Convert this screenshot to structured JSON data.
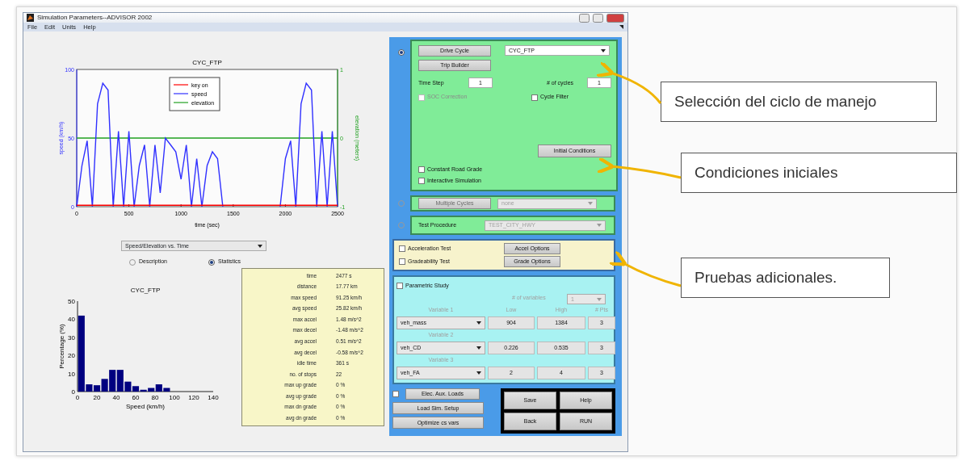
{
  "window": {
    "title": "Simulation Parameters--ADVISOR 2002"
  },
  "menu": [
    "File",
    "Edit",
    "Units",
    "Help"
  ],
  "main_chart": {
    "chart_data": {
      "type": "line",
      "title": "CYC_FTP",
      "xlabel": "time (sec)",
      "ylabel": "speed (km/h)",
      "y2label": "elevation (meters)",
      "xlim": [
        0,
        2500
      ],
      "ylim": [
        0,
        100
      ],
      "y2lim": [
        -1,
        1
      ],
      "xticks": [
        0,
        500,
        1000,
        1500,
        2000,
        2500
      ],
      "yticks": [
        0,
        50,
        100
      ],
      "y2ticks": [
        -1,
        0,
        1
      ],
      "legend": "upper center",
      "x": [
        0,
        50,
        100,
        150,
        200,
        250,
        300,
        350,
        400,
        450,
        500,
        550,
        600,
        650,
        700,
        750,
        800,
        850,
        900,
        950,
        1000,
        1050,
        1100,
        1150,
        1200,
        1250,
        1300,
        1350,
        1400,
        1450,
        1500,
        1550,
        1600,
        1650,
        1700,
        1750,
        1800,
        1850,
        1900,
        1950,
        2000,
        2050,
        2100,
        2150,
        2200,
        2250,
        2300,
        2350,
        2400,
        2450,
        2500
      ],
      "series": [
        {
          "name": "key on",
          "color": "#ff0000",
          "axis": "y",
          "values": [
            1,
            1,
            1,
            1,
            1,
            1,
            1,
            1,
            1,
            1,
            1,
            1,
            1,
            1,
            1,
            1,
            1,
            1,
            1,
            1,
            1,
            1,
            1,
            1,
            1,
            1,
            1,
            1,
            1,
            1,
            1,
            1,
            1,
            1,
            1,
            1,
            1,
            1,
            1,
            1,
            1,
            1,
            1,
            1,
            1,
            1,
            1,
            1,
            1,
            1,
            1
          ]
        },
        {
          "name": "speed",
          "color": "#3030ff",
          "axis": "y",
          "values": [
            0,
            30,
            48,
            0,
            75,
            90,
            85,
            0,
            55,
            0,
            55,
            0,
            30,
            45,
            0,
            45,
            10,
            50,
            45,
            40,
            20,
            45,
            0,
            35,
            0,
            30,
            40,
            35,
            0,
            null,
            null,
            null,
            null,
            null,
            null,
            null,
            null,
            null,
            null,
            0,
            35,
            48,
            0,
            75,
            90,
            85,
            0,
            55,
            0,
            55,
            0
          ]
        },
        {
          "name": "elevation",
          "color": "#20a020",
          "axis": "y2",
          "values": [
            0,
            0,
            0,
            0,
            0,
            0,
            0,
            0,
            0,
            0,
            0,
            0,
            0,
            0,
            0,
            0,
            0,
            0,
            0,
            0,
            0,
            0,
            0,
            0,
            0,
            0,
            0,
            0,
            0,
            0,
            0,
            0,
            0,
            0,
            0,
            0,
            0,
            0,
            0,
            0,
            0,
            0,
            0,
            0,
            0,
            0,
            0,
            0,
            0,
            0,
            0
          ]
        }
      ]
    }
  },
  "plot_select": {
    "value": "Speed/Elevation vs. Time"
  },
  "view_options": [
    {
      "label": "Description",
      "selected": false
    },
    {
      "label": "Statistics",
      "selected": true
    }
  ],
  "histogram": {
    "chart_data": {
      "type": "bar",
      "title": "CYC_FTP",
      "xlabel": "Speed (km/h)",
      "ylabel": "Percentage (%)",
      "xlim": [
        0,
        140
      ],
      "ylim": [
        0,
        50
      ],
      "xticks": [
        0,
        20,
        40,
        60,
        80,
        100,
        120,
        140
      ],
      "yticks": [
        0,
        10,
        20,
        30,
        40,
        50
      ],
      "x": [
        4,
        12,
        20,
        28,
        36,
        44,
        52,
        60,
        68,
        76,
        84,
        92
      ],
      "series": [
        {
          "color": "#000080",
          "values": [
            42,
            4,
            3.5,
            7,
            12,
            12,
            5.5,
            3,
            1,
            2,
            4,
            2
          ]
        }
      ]
    }
  },
  "statistics": [
    {
      "label": "time",
      "value": "2477 s"
    },
    {
      "label": "distance",
      "value": "17.77 km"
    },
    {
      "label": "max speed",
      "value": "91.25 km/h"
    },
    {
      "label": "avg speed",
      "value": "25.82 km/h"
    },
    {
      "label": "max accel",
      "value": "1.48 m/s^2"
    },
    {
      "label": "max decel",
      "value": "-1.48 m/s^2"
    },
    {
      "label": "avg accel",
      "value": "0.51 m/s^2"
    },
    {
      "label": "avg decel",
      "value": "-0.58 m/s^2"
    },
    {
      "label": "idle time",
      "value": "361 s"
    },
    {
      "label": "no. of stops",
      "value": "22"
    },
    {
      "label": "max up grade",
      "value": "0 %"
    },
    {
      "label": "avg up grade",
      "value": "0 %"
    },
    {
      "label": "max dn grade",
      "value": "0 %"
    },
    {
      "label": "avg dn grade",
      "value": "0 %"
    }
  ],
  "drive_cycle_panel": {
    "selected": true,
    "drive_cycle_button": "Drive Cycle",
    "trip_builder_button": "Trip Builder",
    "cycle_select": "CYC_FTP",
    "time_step": {
      "label": "Time Step",
      "value": "1"
    },
    "cycles": {
      "label": "# of cycles",
      "value": "1"
    },
    "checkboxes": [
      {
        "label": "SOC Correction",
        "checked": false,
        "disabled": true
      },
      {
        "label": "Cycle Filter",
        "checked": false,
        "disabled": false
      }
    ],
    "initial_conditions_button": "Initial Conditions",
    "options": [
      {
        "label": "Constant Road Grade",
        "checked": false
      },
      {
        "label": "Interactive Simulation",
        "checked": false
      }
    ]
  },
  "multiple_cycles_panel": {
    "selected": false,
    "button": "Multiple Cycles",
    "select": "none"
  },
  "test_procedure_panel": {
    "selected": false,
    "label": "Test Procedure",
    "select": "TEST_CITY_HWY"
  },
  "additional_tests": [
    {
      "label": "Acceleration Test",
      "checked": false,
      "button": "Accel Options"
    },
    {
      "label": "Gradeability Test",
      "checked": false,
      "button": "Grade Options"
    }
  ],
  "parametric_study": {
    "label": "Parametric Study",
    "checked": false,
    "count_label": "# of variables",
    "count": "1",
    "columns": [
      "Low",
      "High",
      "# Pts"
    ],
    "variables": [
      {
        "heading": "Variable 1",
        "name": "veh_mass",
        "low": "904",
        "high": "1384",
        "points": "3"
      },
      {
        "heading": "Variable 2",
        "name": "veh_CD",
        "low": "0.226",
        "high": "0.535",
        "points": "3"
      },
      {
        "heading": "Variable 3",
        "name": "veh_FA",
        "low": "2",
        "high": "4",
        "points": "3"
      }
    ]
  },
  "elec_aux": {
    "checked": false,
    "button": "Elec. Aux. Loads"
  },
  "setup_buttons": [
    "Load Sim. Setup",
    "Optimize cs vars"
  ],
  "action_buttons": [
    "Save",
    "Help",
    "Back",
    "RUN"
  ],
  "callouts": [
    "Selección del ciclo de manejo",
    "Condiciones iniciales",
    "Pruebas adicionales."
  ]
}
